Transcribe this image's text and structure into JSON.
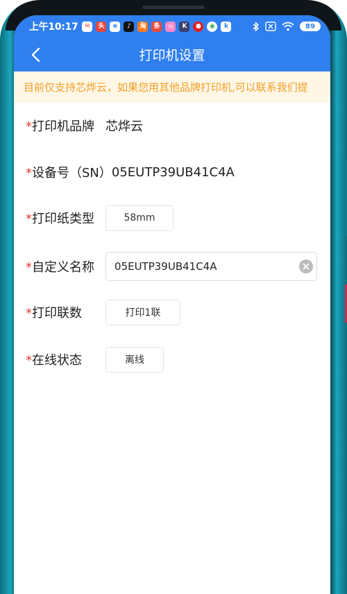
{
  "status_bar": {
    "time": "上午10:17",
    "battery": "89",
    "app_icons": [
      "message-icon",
      "toutiao-icon",
      "browser-icon",
      "tiktok-icon",
      "taobao-icon",
      "toutiao-news-icon",
      "gallery-icon",
      "k-icon",
      "netease-icon",
      "chrome-icon",
      "k-app-icon"
    ]
  },
  "header": {
    "title": "打印机设置"
  },
  "notice": {
    "text": "目前仅支持芯烨云，如果您用其他品牌打印机,可以联系我们提"
  },
  "form": {
    "required_mark": "*",
    "brand": {
      "label": "打印机品牌",
      "value": "芯烨云"
    },
    "device": {
      "label": "设备号（SN）",
      "value": "05EUTP39UB41C4A"
    },
    "paper": {
      "label": "打印纸类型",
      "value": "58mm"
    },
    "name": {
      "label": "自定义名称",
      "value": "05EUTP39UB41C4A"
    },
    "copies": {
      "label": "打印联数",
      "value": "打印1联"
    },
    "online": {
      "label": "在线状态",
      "value": "离线"
    }
  },
  "colors": {
    "primary": "#2f7fef",
    "notice_bg": "#fff7e6",
    "notice_text": "#f0a02a",
    "required": "#e03c31"
  }
}
